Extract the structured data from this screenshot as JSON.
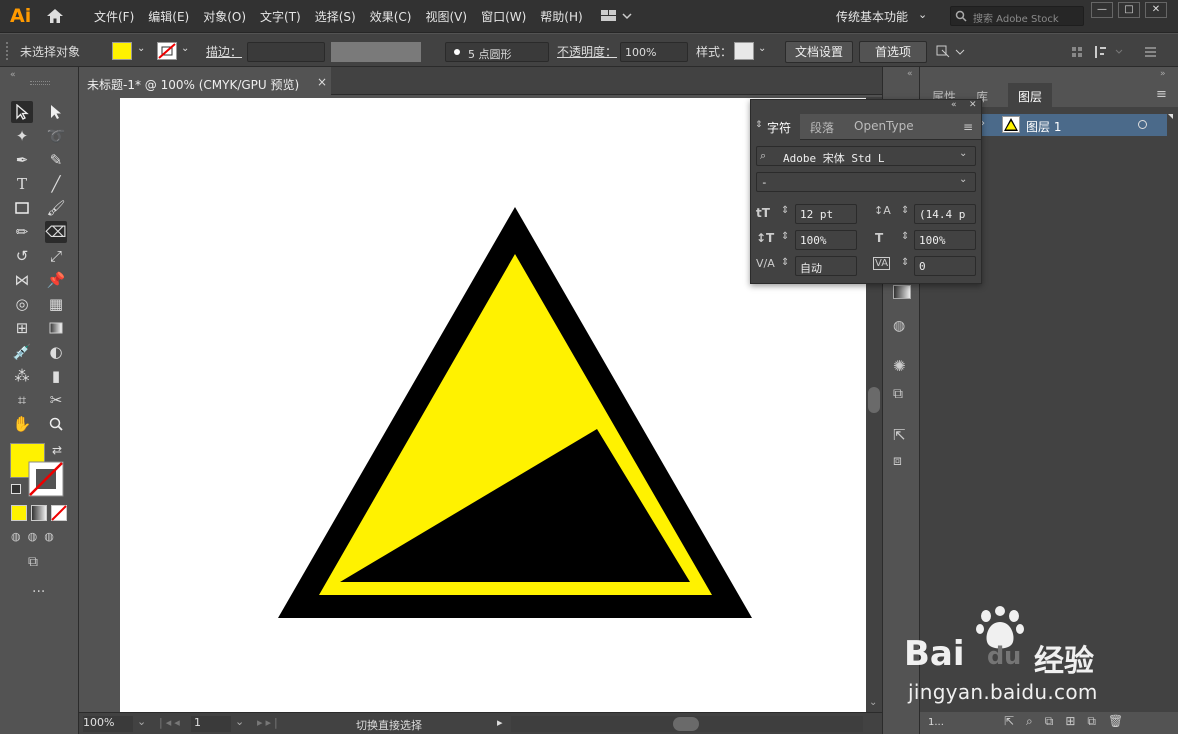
{
  "app": {
    "logo": "Ai",
    "menu": [
      "文件(F)",
      "编辑(E)",
      "对象(O)",
      "文字(T)",
      "选择(S)",
      "效果(C)",
      "视图(V)",
      "窗口(W)",
      "帮助(H)"
    ],
    "workspace": "传统基本功能",
    "search_placeholder": "搜索 Adobe Stock",
    "window_controls": [
      "—",
      "□",
      "✕"
    ]
  },
  "control_bar": {
    "no_selection": "未选择对象",
    "stroke_label": "描边：",
    "brush_label": "5 点圆形",
    "opacity_label": "不透明度：",
    "opacity_value": "100%",
    "style_label": "样式：",
    "doc_setup": "文档设置",
    "preferences": "首选项",
    "fill_color": "#fff200"
  },
  "document": {
    "tab_title": "未标题-1* @ 100% (CMYK/GPU 预览)",
    "close": "×"
  },
  "status_bar": {
    "zoom": "100%",
    "artboard_num": "1",
    "status_text": "切换直接选择"
  },
  "right_panel": {
    "tabs": [
      "属性",
      "库",
      "图层"
    ],
    "layer_name": "图层 1",
    "layer_count": "1..."
  },
  "character_panel": {
    "tabs": [
      "字符",
      "段落",
      "OpenType"
    ],
    "font_family": "Adobe 宋体 Std L",
    "font_style": "-",
    "font_size": "12 pt",
    "leading": "(14.4 p",
    "vertical_scale": "100%",
    "horizontal_scale": "100%",
    "kerning": "自动",
    "tracking": "0"
  },
  "artwork": {
    "outer_color": "#000000",
    "inner_color": "#fff200",
    "wedge_color": "#000000"
  },
  "watermark": {
    "brand": "Bai",
    "brand_suffix": "du",
    "product": "经验",
    "url": "jingyan.baidu.com"
  }
}
